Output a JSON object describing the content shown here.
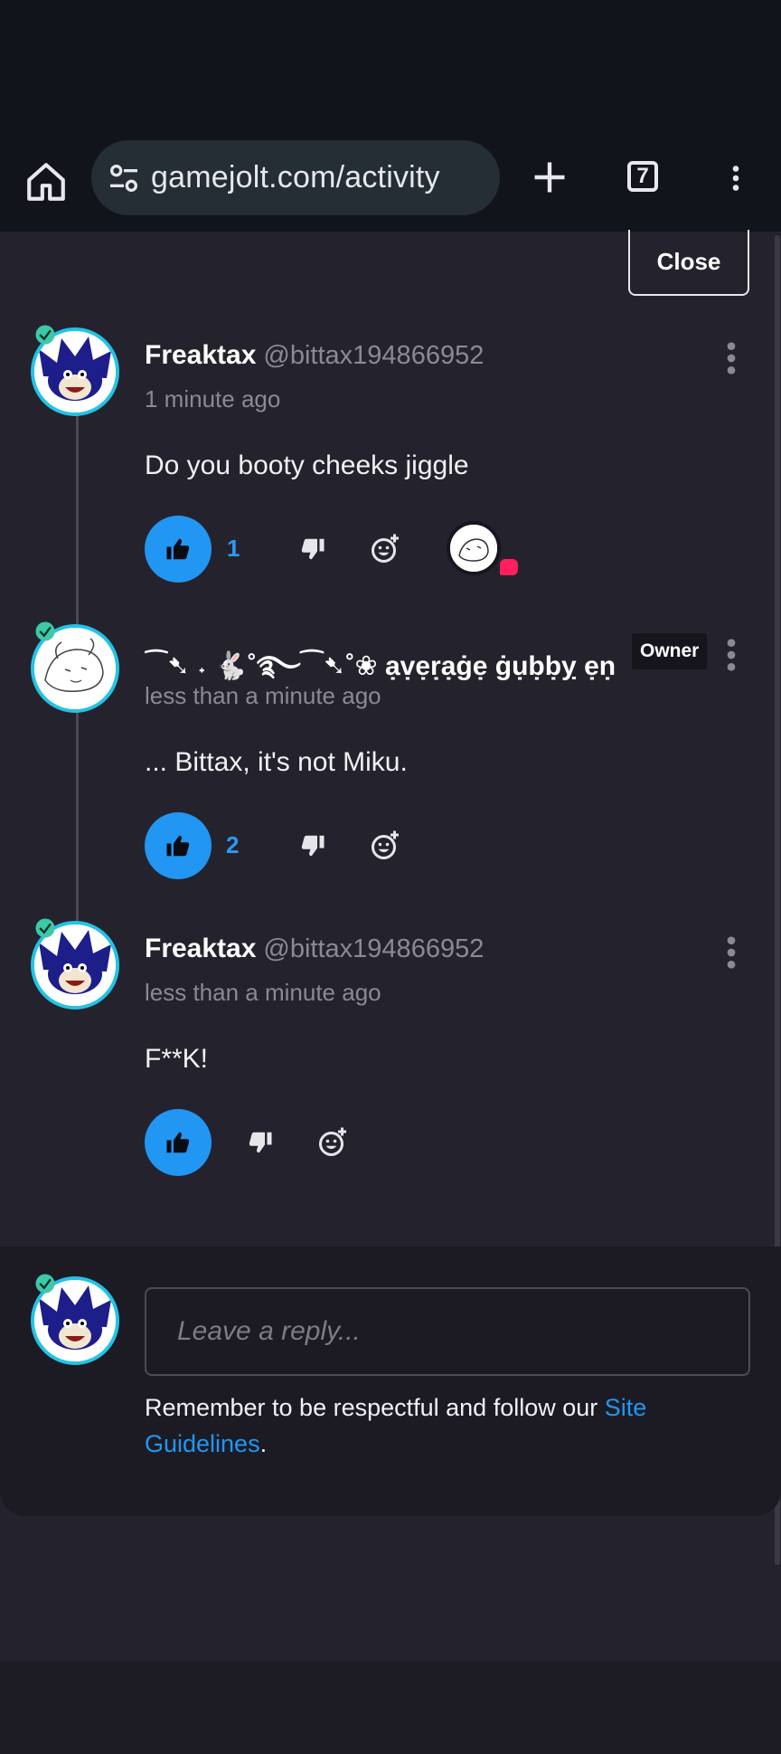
{
  "browser": {
    "url": "gamejolt.com/activity",
    "tab_count": "7"
  },
  "panel": {
    "close_label": "Close"
  },
  "comments": [
    {
      "name": "Freaktax",
      "handle": "@bittax194866952",
      "time": "1 minute ago",
      "body": "Do you booty cheeks jiggle",
      "like_count": "1",
      "has_reaction": true
    },
    {
      "name": "⁀➷ ˖ 🐇˚࿐⁀➷˚❀ ạṿẹṛạġẹ ġụḅḅỵ ẹṇịọ...",
      "badge": "Owner",
      "time": "less than a minute ago",
      "body": "... Bittax, it's not Miku.",
      "like_count": "2"
    },
    {
      "name": "Freaktax",
      "handle": "@bittax194866952",
      "time": "less than a minute ago",
      "body": "F**K!",
      "like_count": ""
    }
  ],
  "reply": {
    "placeholder": "Leave a reply...",
    "guidelines_prefix": "Remember to be respectful and follow our ",
    "guidelines_link": "Site Guidelines",
    "guidelines_suffix": "."
  },
  "colors": {
    "accent": "#2196f3",
    "avatar_ring": "#22c3e6",
    "notification_dot": "#ff1f5a"
  }
}
